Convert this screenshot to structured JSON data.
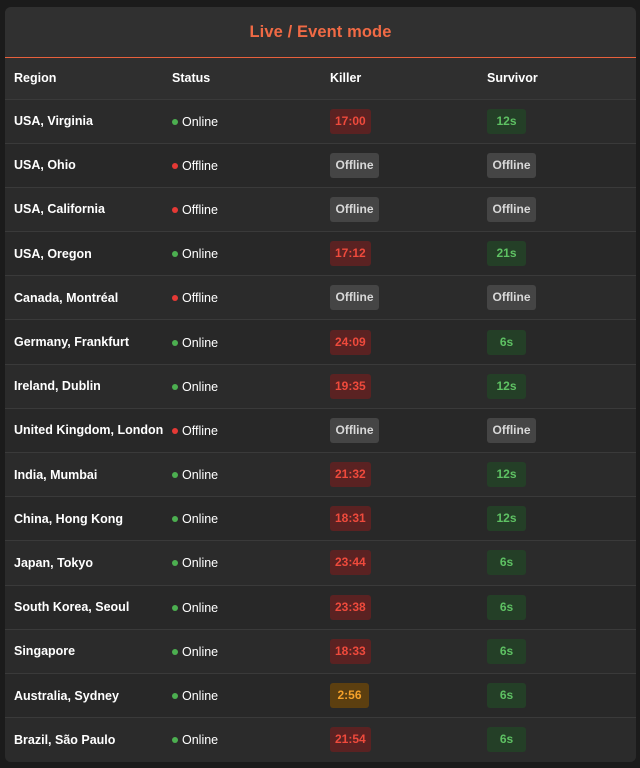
{
  "title": "Live / Event mode",
  "columns": {
    "region": "Region",
    "status": "Status",
    "killer": "Killer",
    "survivor": "Survivor"
  },
  "colors": {
    "accent": "#f06a45",
    "online_dot": "#4caf50",
    "offline_dot": "#e53935",
    "killer_red_text": "#ef4a3c",
    "killer_orange_text": "#f5a12a",
    "survivor_green_text": "#5ec163"
  },
  "rows": [
    {
      "region": "USA, Virginia",
      "status": "Online",
      "killer": "17:00",
      "killer_style": "red",
      "survivor": "12s"
    },
    {
      "region": "USA, Ohio",
      "status": "Offline",
      "killer": "Offline",
      "killer_style": "off",
      "survivor": "Offline"
    },
    {
      "region": "USA, California",
      "status": "Offline",
      "killer": "Offline",
      "killer_style": "off",
      "survivor": "Offline"
    },
    {
      "region": "USA, Oregon",
      "status": "Online",
      "killer": "17:12",
      "killer_style": "red",
      "survivor": "21s"
    },
    {
      "region": "Canada, Montréal",
      "status": "Offline",
      "killer": "Offline",
      "killer_style": "off",
      "survivor": "Offline"
    },
    {
      "region": "Germany, Frankfurt",
      "status": "Online",
      "killer": "24:09",
      "killer_style": "red",
      "survivor": "6s"
    },
    {
      "region": "Ireland, Dublin",
      "status": "Online",
      "killer": "19:35",
      "killer_style": "red",
      "survivor": "12s"
    },
    {
      "region": "United Kingdom, London",
      "status": "Offline",
      "killer": "Offline",
      "killer_style": "off",
      "survivor": "Offline"
    },
    {
      "region": "India, Mumbai",
      "status": "Online",
      "killer": "21:32",
      "killer_style": "red",
      "survivor": "12s"
    },
    {
      "region": "China, Hong Kong",
      "status": "Online",
      "killer": "18:31",
      "killer_style": "red",
      "survivor": "12s"
    },
    {
      "region": "Japan, Tokyo",
      "status": "Online",
      "killer": "23:44",
      "killer_style": "red",
      "survivor": "6s"
    },
    {
      "region": "South Korea, Seoul",
      "status": "Online",
      "killer": "23:38",
      "killer_style": "red",
      "survivor": "6s"
    },
    {
      "region": "Singapore",
      "status": "Online",
      "killer": "18:33",
      "killer_style": "red",
      "survivor": "6s"
    },
    {
      "region": "Australia, Sydney",
      "status": "Online",
      "killer": "2:56",
      "killer_style": "orange",
      "survivor": "6s"
    },
    {
      "region": "Brazil, São Paulo",
      "status": "Online",
      "killer": "21:54",
      "killer_style": "red",
      "survivor": "6s"
    }
  ]
}
